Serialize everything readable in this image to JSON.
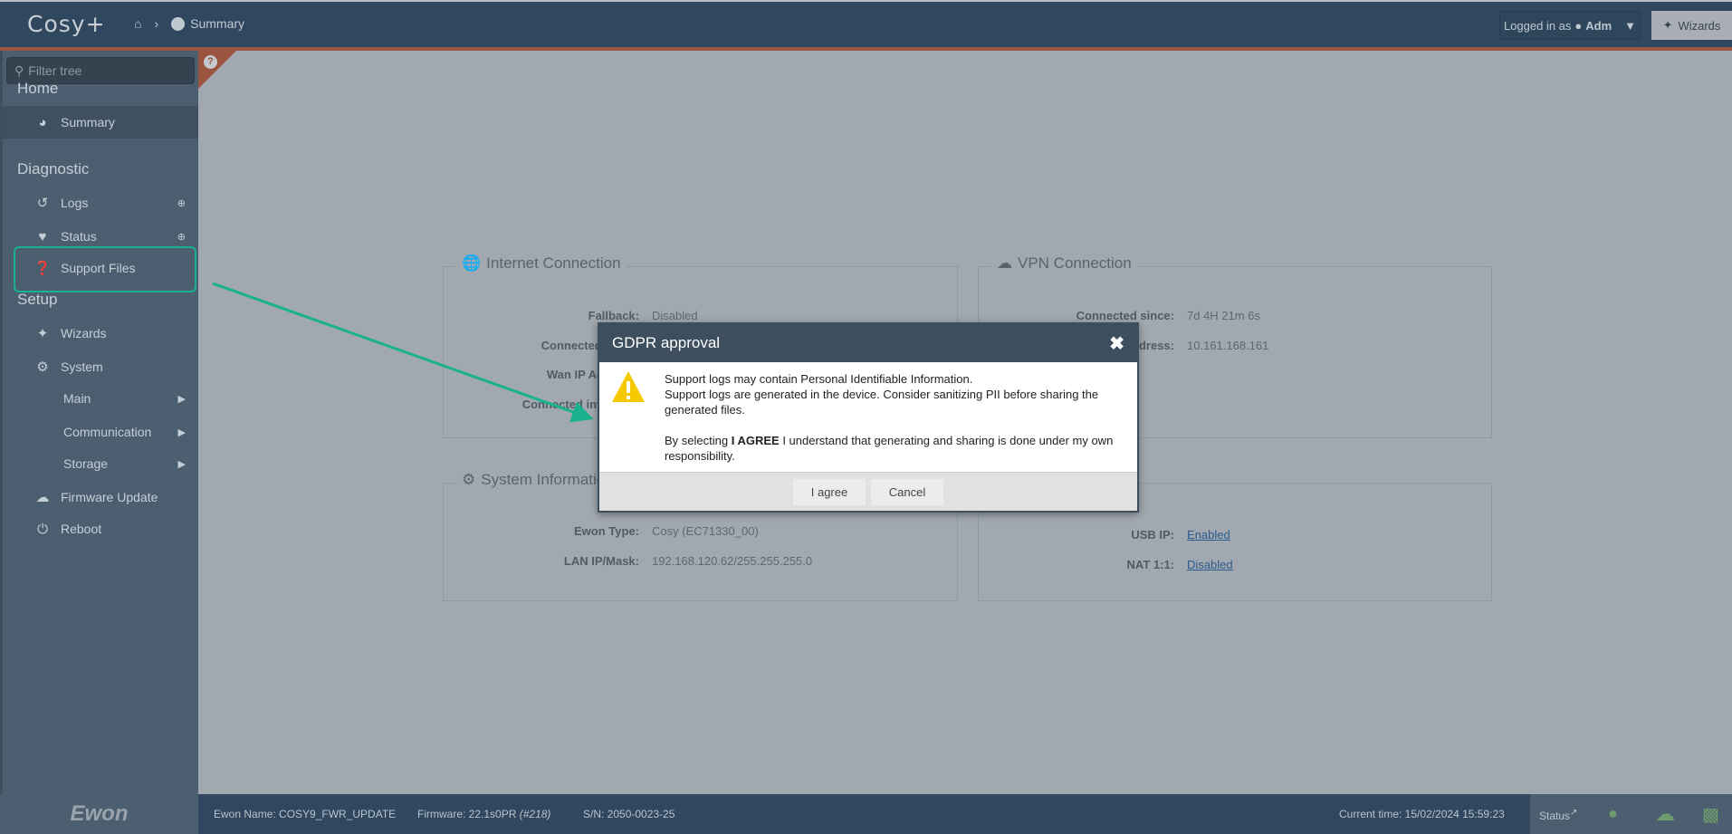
{
  "header": {
    "app_title": "Cosy+",
    "breadcrumb": "Summary",
    "logged_in_prefix": "Logged in as",
    "user": "Adm",
    "wizards_label": "Wizards"
  },
  "sidebar": {
    "filter_placeholder": "Filter tree",
    "sections": {
      "home": "Home",
      "diagnostic": "Diagnostic",
      "setup": "Setup"
    },
    "items": {
      "summary": "Summary",
      "logs": "Logs",
      "status": "Status",
      "support_files": "Support Files",
      "wizards": "Wizards",
      "system": "System",
      "main": "Main",
      "communication": "Communication",
      "storage": "Storage",
      "firmware_update": "Firmware Update",
      "reboot": "Reboot"
    }
  },
  "internet": {
    "title": "Internet Connection",
    "rows": [
      {
        "k": "Fallback:",
        "v": "Disabled"
      },
      {
        "k": "Connected since:",
        "v": ""
      },
      {
        "k": "Wan IP Address:",
        "v": ""
      },
      {
        "k": "Connected interface:",
        "v": ""
      }
    ]
  },
  "vpn": {
    "title": "VPN Connection",
    "rows": [
      {
        "k": "Connected since:",
        "v": "7d 4H 21m 6s"
      },
      {
        "k": "VPN IP Address:",
        "v": "10.161.168.161"
      }
    ]
  },
  "system": {
    "title": "System Information",
    "rows": [
      {
        "k": "Ewon Type:",
        "v": "Cosy (EC71330_00)"
      },
      {
        "k": "LAN IP/Mask:",
        "v": "192.168.120.62/255.255.255.0"
      }
    ]
  },
  "services": {
    "rows": [
      {
        "k": "USB IP:",
        "v": "Enabled"
      },
      {
        "k": "NAT 1:1:",
        "v": "Disabled"
      }
    ]
  },
  "dialog": {
    "title": "GDPR approval",
    "line1": "Support logs may contain Personal Identifiable Information.",
    "line2": "Support logs are generated in the device. Consider sanitizing PII before sharing the generated files.",
    "line3_pre": "By selecting",
    "line3_bold": "I AGREE",
    "line3_post": "I understand that generating and sharing is done under my own responsibility.",
    "agree": "I agree",
    "cancel": "Cancel"
  },
  "footer": {
    "logo": "Ewon",
    "name": "Ewon Name: COSY9_FWR_UPDATE",
    "firmware": "Firmware: 22.1s0PR",
    "build": "(#218)",
    "sn": "S/N: 2050-0023-25",
    "time": "Current time: 15/02/2024 15:59:23",
    "status": "Status"
  },
  "colors": {
    "accent": "#9a5440",
    "highlight": "#19b28e",
    "warning": "#f5c800",
    "link": "#2b5c8f"
  }
}
